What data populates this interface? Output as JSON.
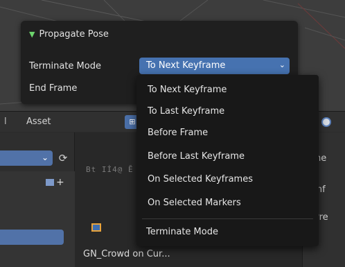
{
  "popup": {
    "title": "Propagate Pose",
    "terminate_mode_label": "Terminate Mode",
    "terminate_mode_value": "To Next Keyframe",
    "end_frame_label": "End Frame"
  },
  "menu": {
    "items": [
      "To Next Keyframe",
      "To Last Keyframe",
      "Before Frame",
      "Before Last Keyframe",
      "On Selected Keyframes",
      "On Selected Markers"
    ],
    "footer_title": "Terminate Mode"
  },
  "editor_header": {
    "left_edge_text": "l",
    "asset_menu": "Asset"
  },
  "asset_area": {
    "asset_name": "GN_Crowd on Cur...",
    "thumb_text": "Bt Iİ4@ Ӗ"
  },
  "right_panel": {
    "name_label": "lame",
    "info_label": "Inf",
    "preview_label": "Pre"
  },
  "colors": {
    "accent": "#4672b0",
    "popup_bg": "#1f1f1f",
    "menu_bg": "#181818",
    "triangle": "#6cd46c"
  }
}
